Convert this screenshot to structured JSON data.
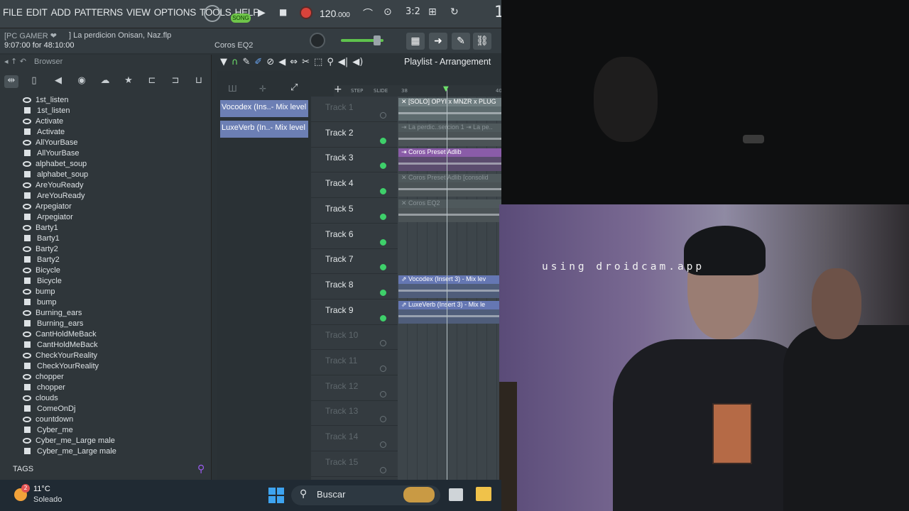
{
  "menu": [
    "FILE",
    "EDIT",
    "ADD",
    "PATTERNS",
    "VIEW",
    "OPTIONS",
    "TOOLS",
    "HELP"
  ],
  "transport": {
    "mode": "SONG",
    "tempo": "120",
    "tempo_frac": ".000",
    "digit": "1"
  },
  "project": {
    "tag": "[PC GAMER ❤",
    "file": "] La perdicion Onisan, Naz.flp",
    "time": "9:07:00 for 48:10:00",
    "hint": "Coros EQ2"
  },
  "browser": {
    "title": "Browser",
    "items": [
      {
        "label": "1st_listen",
        "icon": "wave"
      },
      {
        "label": "1st_listen",
        "icon": "pat"
      },
      {
        "label": "Activate",
        "icon": "wave"
      },
      {
        "label": "Activate",
        "icon": "pat"
      },
      {
        "label": "AllYourBase",
        "icon": "wave"
      },
      {
        "label": "AllYourBase",
        "icon": "pat"
      },
      {
        "label": "alphabet_soup",
        "icon": "wave"
      },
      {
        "label": "alphabet_soup",
        "icon": "pat"
      },
      {
        "label": "AreYouReady",
        "icon": "wave"
      },
      {
        "label": "AreYouReady",
        "icon": "pat"
      },
      {
        "label": "Arpegiator",
        "icon": "wave"
      },
      {
        "label": "Arpegiator",
        "icon": "pat"
      },
      {
        "label": "Barty1",
        "icon": "wave"
      },
      {
        "label": "Barty1",
        "icon": "pat"
      },
      {
        "label": "Barty2",
        "icon": "wave"
      },
      {
        "label": "Barty2",
        "icon": "pat"
      },
      {
        "label": "Bicycle",
        "icon": "wave"
      },
      {
        "label": "Bicycle",
        "icon": "pat"
      },
      {
        "label": "bump",
        "icon": "wave"
      },
      {
        "label": "bump",
        "icon": "pat"
      },
      {
        "label": "Burning_ears",
        "icon": "wave"
      },
      {
        "label": "Burning_ears",
        "icon": "pat"
      },
      {
        "label": "CantHoldMeBack",
        "icon": "wave"
      },
      {
        "label": "CantHoldMeBack",
        "icon": "pat"
      },
      {
        "label": "CheckYourReality",
        "icon": "wave"
      },
      {
        "label": "CheckYourReality",
        "icon": "pat"
      },
      {
        "label": "chopper",
        "icon": "wave"
      },
      {
        "label": "chopper",
        "icon": "pat"
      },
      {
        "label": "clouds",
        "icon": "wave"
      },
      {
        "label": "ComeOnDj",
        "icon": "pat"
      },
      {
        "label": "countdown",
        "icon": "wave"
      },
      {
        "label": "Cyber_me",
        "icon": "pat"
      },
      {
        "label": "Cyber_me_Large male",
        "icon": "wave"
      },
      {
        "label": "Cyber_me_Large male",
        "icon": "pat"
      }
    ],
    "tags_label": "TAGS"
  },
  "picker": {
    "items": [
      "Vocodex (Ins..- Mix level",
      "LuxeVerb (In..- Mix level"
    ]
  },
  "playlist": {
    "title": "Playlist - Arrangement",
    "ruler": {
      "step": "STEP",
      "slide": "SLIDE",
      "bar1": "38",
      "bar2": "40"
    },
    "tracks": [
      {
        "name": "Track 1",
        "dim": true,
        "led": false
      },
      {
        "name": "Track 2",
        "dim": false,
        "led": true
      },
      {
        "name": "Track 3",
        "dim": false,
        "led": true
      },
      {
        "name": "Track 4",
        "dim": false,
        "led": true
      },
      {
        "name": "Track 5",
        "dim": false,
        "led": true
      },
      {
        "name": "Track 6",
        "dim": false,
        "led": true
      },
      {
        "name": "Track 7",
        "dim": false,
        "led": true
      },
      {
        "name": "Track 8",
        "dim": false,
        "led": true
      },
      {
        "name": "Track 9",
        "dim": false,
        "led": true
      },
      {
        "name": "Track 10",
        "dim": true,
        "led": false
      },
      {
        "name": "Track 11",
        "dim": true,
        "led": false
      },
      {
        "name": "Track 12",
        "dim": true,
        "led": false
      },
      {
        "name": "Track 13",
        "dim": true,
        "led": false
      },
      {
        "name": "Track 14",
        "dim": true,
        "led": false
      },
      {
        "name": "Track 15",
        "dim": true,
        "led": false
      }
    ],
    "clips": [
      {
        "track": 0,
        "label": "✕ [SOLO] OPYI x MNZR x PLUG",
        "color": "gray"
      },
      {
        "track": 1,
        "label": "⇥ La perdic..sercion 1  ⇥ La pe..",
        "color": "dim"
      },
      {
        "track": 2,
        "label": "⇥ Coros Preset Adlib",
        "color": "purple"
      },
      {
        "track": 3,
        "label": "✕ Coros Preset Adlib [consolid",
        "color": "dim"
      },
      {
        "track": 4,
        "label": "✕ Coros EQ2",
        "color": "dim"
      },
      {
        "track": 7,
        "label": "⇗ Vocodex (Insert 3) - Mix lev",
        "color": "blue"
      },
      {
        "track": 8,
        "label": "⇗ LuxeVerb (Insert 3) - Mix le",
        "color": "blue"
      }
    ]
  },
  "cam": {
    "overlay": "using droidcam.app"
  },
  "taskbar": {
    "weather_badge": "2",
    "temp": "11°C",
    "condition": "Soleado",
    "search": "Buscar"
  },
  "colors": {
    "accent_green": "#5fc24d",
    "clip_blue": "#6577b3",
    "clip_purple": "#8a5ca8",
    "record": "#d9433b"
  }
}
